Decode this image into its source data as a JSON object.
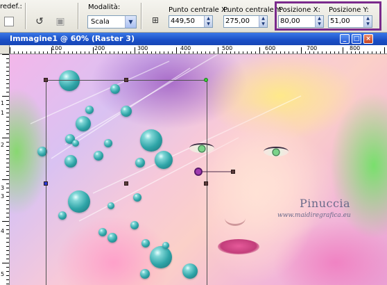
{
  "toolbar": {
    "preset_label": "redef.:",
    "mode_label": "Modalità:",
    "mode_value": "Scala",
    "center_x_label": "Punto centrale X:",
    "center_x_value": "449,50",
    "center_y_label": "Punto centrale Y:",
    "center_y_value": "275,00",
    "pos_x_label": "Posizione X:",
    "pos_x_value": "80,00",
    "pos_y_label": "Posizione Y:",
    "pos_y_value": "51,00"
  },
  "window": {
    "title": "Immagine1 @ 60% (Raster 3)"
  },
  "rulers": {
    "horizontal": [
      "100",
      "200",
      "300",
      "400",
      "500",
      "600",
      "700",
      "800"
    ],
    "vertical": [
      "1",
      "1",
      "2",
      "3",
      "3",
      "4",
      "5"
    ]
  },
  "watermark": {
    "name": "Pinuccia",
    "url": "www.maidiregrafica.eu"
  },
  "colors": {
    "highlight": "#7a2a8c",
    "titlebar": "#1a4fc6",
    "bubble": "#2fa5a8"
  }
}
